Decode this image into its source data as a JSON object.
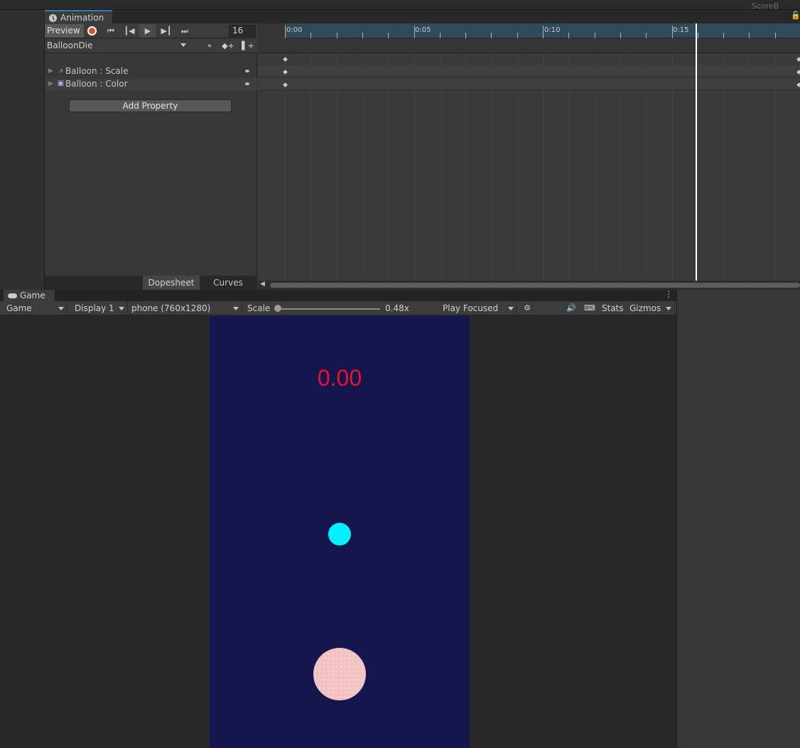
{
  "scene_label": "ScoreB",
  "animation": {
    "tab_title": "Animation",
    "preview_label": "Preview",
    "frame": "16",
    "clip_name": "BalloonDie",
    "properties": [
      {
        "label": "Balloon : Scale",
        "icon": "scale-icon"
      },
      {
        "label": "Balloon : Color",
        "icon": "color-icon"
      }
    ],
    "add_property_label": "Add Property",
    "tabs": {
      "dopesheet": "Dopesheet",
      "curves": "Curves"
    },
    "timeline": {
      "ticks": [
        "0:00",
        "0:05",
        "0:10",
        "0:15"
      ],
      "playhead_frame": 16,
      "keyframe_time": "0:00"
    }
  },
  "game": {
    "tab_title": "Game",
    "mode": "Game",
    "display": "Display 1",
    "resolution": "phone (760x1280)",
    "scale_label": "Scale",
    "scale_value": "0.48x",
    "play_mode": "Play Focused",
    "stats_label": "Stats",
    "gizmos_label": "Gizmos",
    "score": "0.00",
    "colors": {
      "background": "#16164e",
      "score": "#e8132f",
      "cyan_ball": "#00f0ff",
      "pink_balloon": "#f3c2c3"
    }
  }
}
